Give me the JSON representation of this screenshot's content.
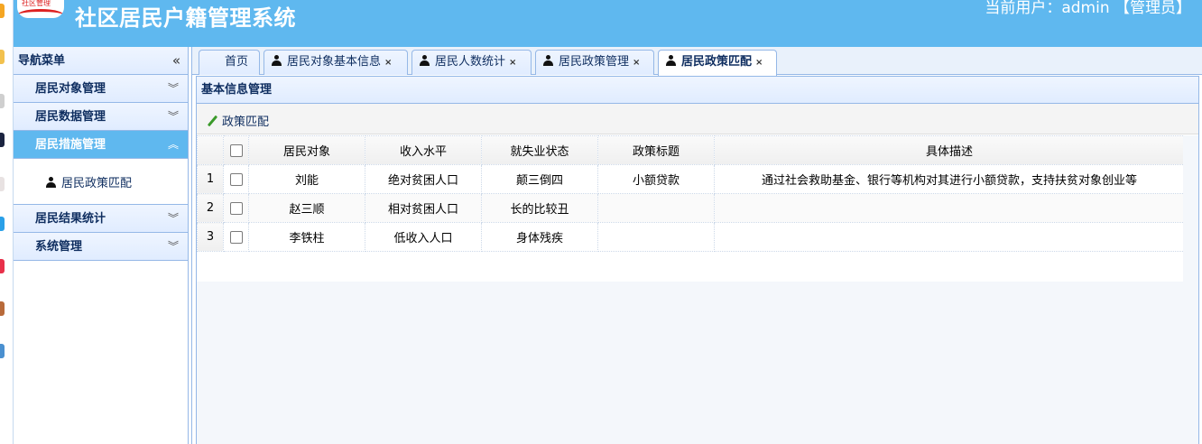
{
  "header": {
    "logo_text": "社区管理",
    "title": "社区居民户籍管理系统",
    "user_info": "当前用户：admin 【管理员】"
  },
  "sidebar": {
    "title": "导航菜单",
    "items": [
      {
        "label": "居民对象管理",
        "active": false
      },
      {
        "label": "居民数据管理",
        "active": false
      },
      {
        "label": "居民措施管理",
        "active": true,
        "children": [
          "居民政策匹配"
        ]
      },
      {
        "label": "居民结果统计",
        "active": false
      },
      {
        "label": "系统管理",
        "active": false
      }
    ]
  },
  "tabs": [
    {
      "label": "首页",
      "closable": false,
      "icon": "none"
    },
    {
      "label": "居民对象基本信息",
      "closable": true,
      "icon": "person-icon"
    },
    {
      "label": "居民人数统计",
      "closable": true,
      "icon": "person-icon"
    },
    {
      "label": "居民政策管理",
      "closable": true,
      "icon": "person-icon"
    },
    {
      "label": "居民政策匹配",
      "closable": true,
      "icon": "person-icon",
      "active": true
    }
  ],
  "panel": {
    "title": "基本信息管理",
    "toolbar_button": "政策匹配"
  },
  "table": {
    "columns": [
      "居民对象",
      "收入水平",
      "就失业状态",
      "政策标题",
      "具体描述"
    ],
    "rows": [
      {
        "n": "1",
        "cells": [
          "刘能",
          "绝对贫困人口",
          "颠三倒四",
          "小额贷款",
          "通过社会救助基金、银行等机构对其进行小额贷款，支持扶贫对象创业等"
        ]
      },
      {
        "n": "2",
        "cells": [
          "赵三顺",
          "相对贫困人口",
          "长的比较丑",
          "",
          ""
        ]
      },
      {
        "n": "3",
        "cells": [
          "李铁柱",
          "低收入人口",
          "身体残疾",
          "",
          ""
        ]
      }
    ]
  },
  "colors": {
    "header_bg": "#5fb8ef",
    "active_menu_bg": "#5fb8ef",
    "border": "#95b8e7",
    "text_dark": "#0e2d5f"
  }
}
